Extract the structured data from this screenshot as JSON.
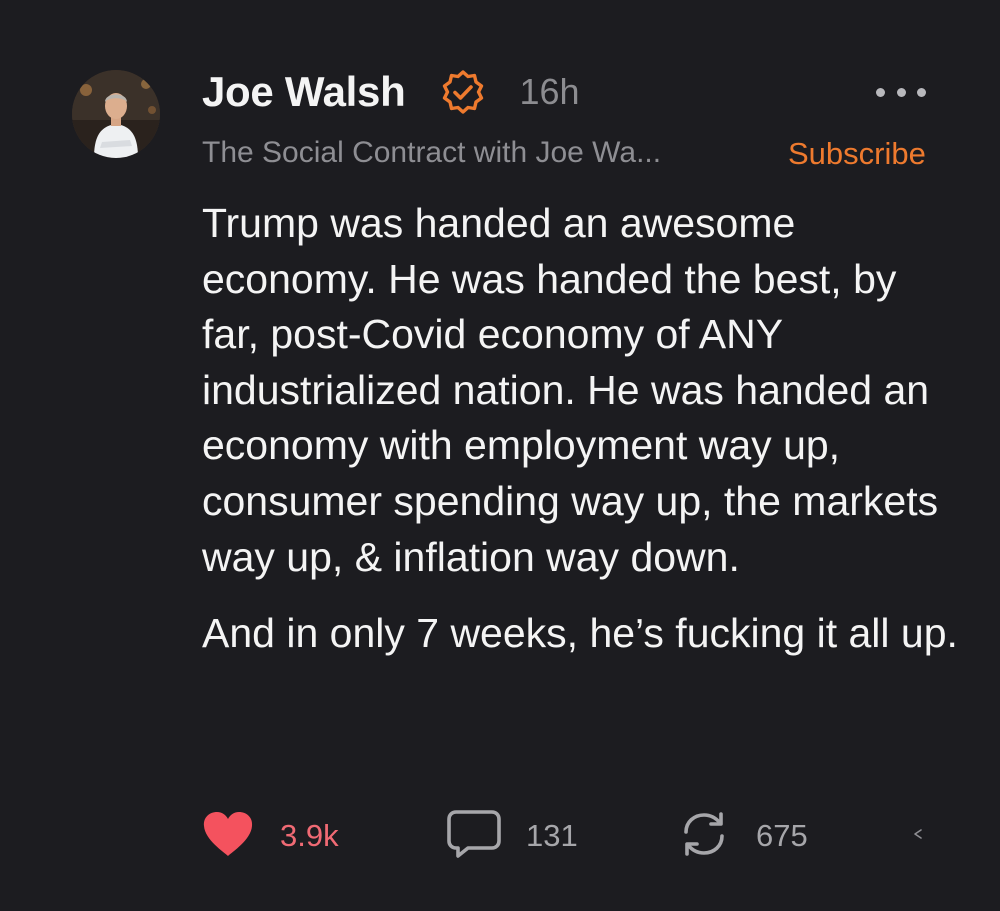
{
  "post": {
    "author": {
      "name": "Joe Walsh",
      "verified": true,
      "avatar": "avatar-photo"
    },
    "timestamp": "16h",
    "publication": "The Social Contract with Joe Wa...",
    "subscribe_label": "Subscribe",
    "paragraphs": [
      "Trump was handed an awesome economy. He was handed the best, by far, post-Covid economy of ANY industrialized nation. He was handed an economy with employment way up, consumer spending way up, the markets way up, & inflation way down.",
      "And in only 7 weeks, he’s fucking it all up."
    ],
    "actions": {
      "likes": "3.9k",
      "comments": "131",
      "restacks": "675"
    }
  },
  "icons": {
    "verified": "verified-check-icon",
    "more": "more-dots-icon",
    "like": "heart-icon",
    "comment": "comment-bubble-icon",
    "restack": "restack-arrows-icon",
    "share": "share-arrow-icon"
  },
  "colors": {
    "background": "#1c1c20",
    "accent": "#ee7a2e",
    "like": "#f06a74",
    "muted": "#8e8e93",
    "text": "#f4f4f4"
  }
}
